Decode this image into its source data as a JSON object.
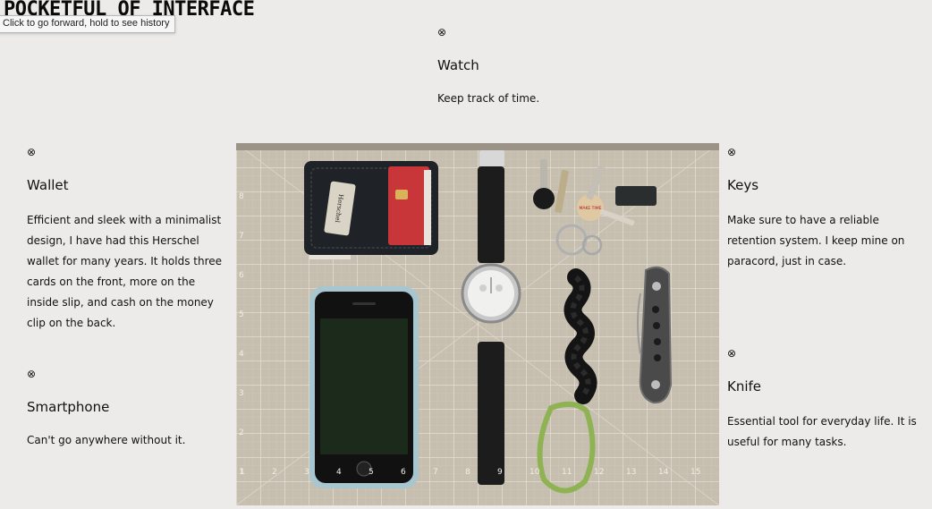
{
  "site": {
    "title": "POCKETFUL OF INTERFACE"
  },
  "tooltip": {
    "text": "Click to go forward, hold to see history"
  },
  "items": {
    "watch": {
      "icon": "⊗",
      "title": "Watch",
      "description": "Keep track of time."
    },
    "wallet": {
      "icon": "⊗",
      "title": "Wallet",
      "description": "Efficient and sleek with a minimalist design, I have had this Herschel wallet for many years. It holds three cards on the front, more on the inside slip, and cash on the money clip on the back."
    },
    "smartphone": {
      "icon": "⊗",
      "title": "Smartphone",
      "description": "Can't go anywhere without it."
    },
    "keys": {
      "icon": "⊗",
      "title": "Keys",
      "description": "Make sure to have a reliable retention system. I keep mine on paracord, just in case."
    },
    "knife": {
      "icon": "⊗",
      "title": "Knife",
      "description": "Essential tool for everyday life. It is useful for many tasks."
    }
  },
  "photo": {
    "wallet_brand": "Herschel",
    "keychain_tag": "MAKE TIME",
    "mat_numbers": [
      "1",
      "2",
      "3",
      "4",
      "5",
      "6",
      "7",
      "8",
      "9",
      "10",
      "11",
      "12",
      "13",
      "14",
      "15"
    ],
    "side_numbers": [
      "1",
      "2",
      "3",
      "4",
      "5",
      "6",
      "7",
      "8"
    ]
  },
  "colors": {
    "background": "#ecebe9",
    "text": "#111111",
    "mat": "#c9c2b3",
    "mat_grid": "#e9e4da"
  }
}
